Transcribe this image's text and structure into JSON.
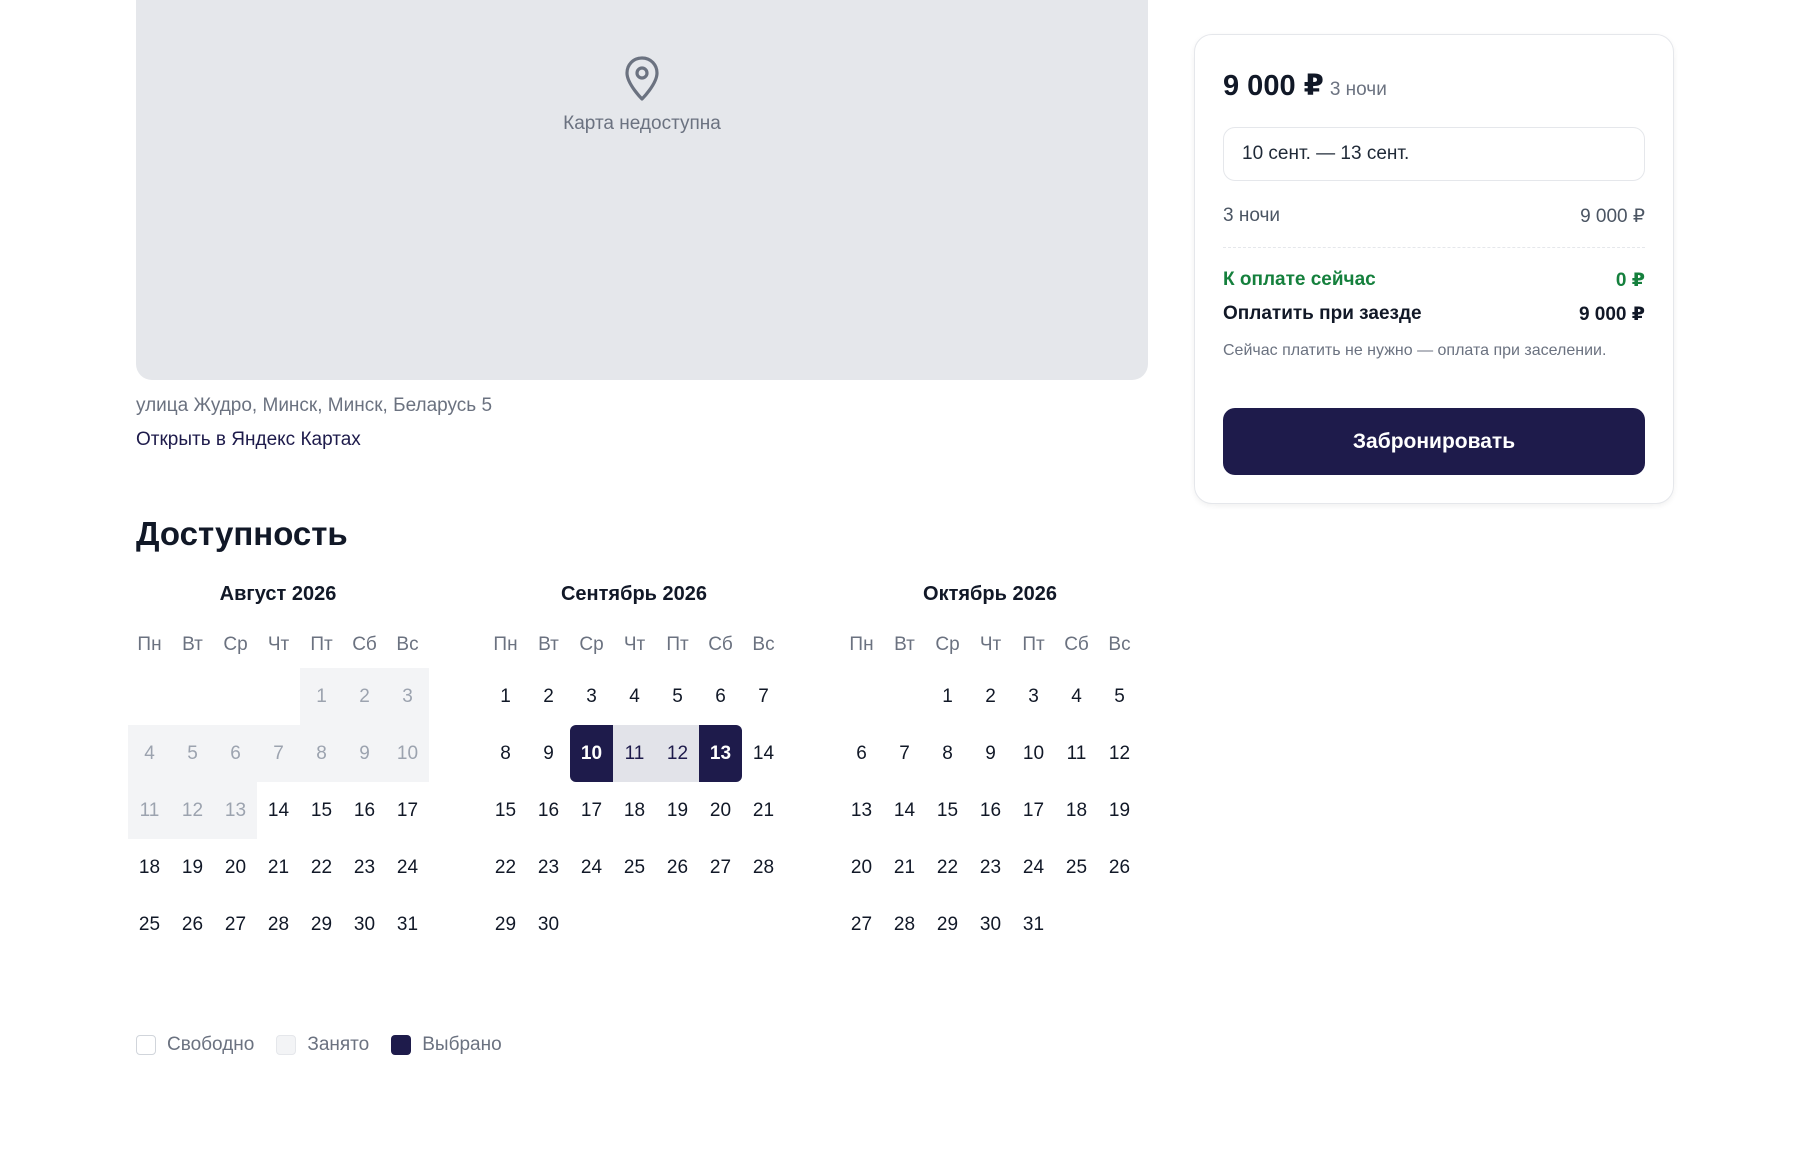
{
  "map": {
    "unavailable_text": "Карта недоступна",
    "icon": "map-pin-icon"
  },
  "address": "улица Жудро, Минск, Минск, Беларусь 5",
  "map_link": "Открыть в Яндекс Картах",
  "availability": {
    "title": "Доступность",
    "weekdays": [
      "Пн",
      "Вт",
      "Ср",
      "Чт",
      "Пт",
      "Сб",
      "Вс"
    ],
    "months": [
      {
        "title": "Август 2026",
        "first_weekday": 5,
        "days": 31,
        "busy": [
          1,
          2,
          3,
          4,
          5,
          6,
          7,
          8,
          9,
          10,
          11,
          12,
          13
        ],
        "selected": [],
        "in_range": []
      },
      {
        "title": "Сентябрь 2026",
        "first_weekday": 1,
        "days": 30,
        "busy": [],
        "selected": [
          10,
          13
        ],
        "in_range": [
          11,
          12
        ]
      },
      {
        "title": "Октябрь 2026",
        "first_weekday": 3,
        "days": 31,
        "busy": [],
        "selected": [],
        "in_range": []
      }
    ]
  },
  "legend": {
    "free": "Свободно",
    "busy": "Занято",
    "selected": "Выбрано"
  },
  "booking": {
    "price": "9 000 ₽",
    "price_nights": "3 ночи",
    "dates": "10 сент. — 13 сент.",
    "nights_label": "3 ночи",
    "nights_total": "9 000 ₽",
    "pay_now_label": "К оплате сейчас",
    "pay_now_value": "0 ₽",
    "pay_arrival_label": "Оплатить при заезде",
    "pay_arrival_value": "9 000 ₽",
    "note": "Сейчас платить не нужно — оплата при заселении.",
    "button": "Забронировать"
  },
  "colors": {
    "accent": "#1e1b4b",
    "success": "#15803d",
    "busy_bg": "#f3f4f6",
    "map_bg": "#e5e7eb"
  }
}
